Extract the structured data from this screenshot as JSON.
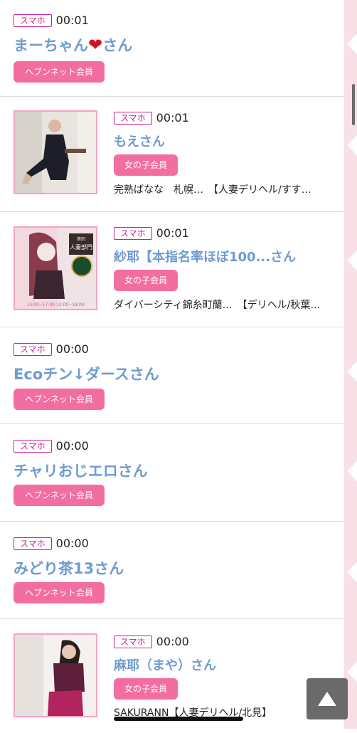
{
  "items": [
    {
      "tag": "スマホ",
      "time": "00:01",
      "name": "まーちゃん",
      "heart": "❤",
      "suffix": "さん",
      "badge": "ヘブンネット会員"
    },
    {
      "tag": "スマホ",
      "time": "00:01",
      "name": "もえさん",
      "badge": "女の子会員",
      "shop": "完熟ばなな　札幌…　【人妻デリヘル/すす…"
    },
    {
      "tag": "スマホ",
      "time": "00:01",
      "name": "紗耶【本指名率ほぼ100...さん",
      "badge": "女の子会員",
      "shop": "ダイバーシティ錦糸町蘭…　【デリヘル/秋葉…"
    },
    {
      "tag": "スマホ",
      "time": "00:00",
      "name": "Ecoチン↓ダースさん",
      "badge": "ヘブンネット会員"
    },
    {
      "tag": "スマホ",
      "time": "00:00",
      "name": "チャリおじエロさん",
      "badge": "ヘブンネット会員"
    },
    {
      "tag": "スマホ",
      "time": "00:00",
      "name": "みどり茶13さん",
      "badge": "ヘブンネット会員"
    },
    {
      "tag": "スマホ",
      "time": "00:00",
      "name": "麻耶（まや）さん",
      "badge": "女の子会員",
      "shop": "SAKURANN【人妻デリヘル/北見】"
    }
  ],
  "photo3_texts": {
    "award_line1": "第回",
    "award_line2": "人妻部門",
    "hours": "13:00~17:00 12:00~18:00"
  },
  "colors": {
    "tag": "#c8219a",
    "name": "#6f9bd0",
    "badge": "#f26ea0",
    "deco": "#f9dfe6"
  },
  "icons": {
    "scroll_top": "up-triangle-icon",
    "heart": "heart-icon"
  }
}
